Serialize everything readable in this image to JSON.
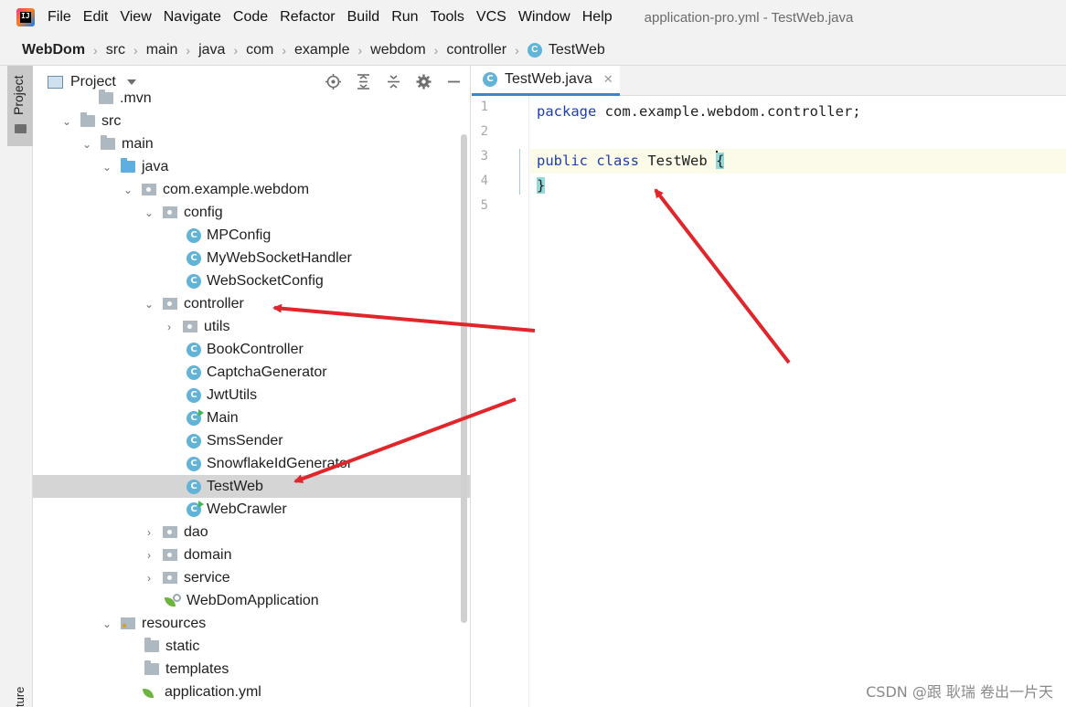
{
  "menubar": {
    "items": [
      "File",
      "Edit",
      "View",
      "Navigate",
      "Code",
      "Refactor",
      "Build",
      "Run",
      "Tools",
      "VCS",
      "Window",
      "Help"
    ],
    "window_title": "application-pro.yml - TestWeb.java"
  },
  "breadcrumb": {
    "items": [
      "WebDom",
      "src",
      "main",
      "java",
      "com",
      "example",
      "webdom",
      "controller",
      "TestWeb"
    ]
  },
  "tool_strip": {
    "project_label": "Project",
    "structure_label": "ture"
  },
  "project_panel": {
    "title": "Project",
    "tree": [
      {
        "label": ".mvn",
        "icon": "folder-icon"
      },
      {
        "label": "src",
        "icon": "folder-icon"
      },
      {
        "label": "main",
        "icon": "folder-icon"
      },
      {
        "label": "java",
        "icon": "source-folder-icon"
      },
      {
        "label": "com.example.webdom",
        "icon": "package-icon"
      },
      {
        "label": "config",
        "icon": "package-icon"
      },
      {
        "label": "MPConfig",
        "icon": "class-icon"
      },
      {
        "label": "MyWebSocketHandler",
        "icon": "class-icon"
      },
      {
        "label": "WebSocketConfig",
        "icon": "class-icon"
      },
      {
        "label": "controller",
        "icon": "package-icon"
      },
      {
        "label": "utils",
        "icon": "package-icon"
      },
      {
        "label": "BookController",
        "icon": "class-icon"
      },
      {
        "label": "CaptchaGenerator",
        "icon": "class-icon"
      },
      {
        "label": "JwtUtils",
        "icon": "class-icon"
      },
      {
        "label": "Main",
        "icon": "runnable-class-icon"
      },
      {
        "label": "SmsSender",
        "icon": "class-icon"
      },
      {
        "label": "SnowflakeIdGenerator",
        "icon": "class-icon"
      },
      {
        "label": "TestWeb",
        "icon": "class-icon"
      },
      {
        "label": "WebCrawler",
        "icon": "runnable-class-icon"
      },
      {
        "label": "dao",
        "icon": "package-icon"
      },
      {
        "label": "domain",
        "icon": "package-icon"
      },
      {
        "label": "service",
        "icon": "package-icon"
      },
      {
        "label": "WebDomApplication",
        "icon": "spring-boot-class-icon"
      },
      {
        "label": "resources",
        "icon": "resources-folder-icon"
      },
      {
        "label": "static",
        "icon": "folder-icon"
      },
      {
        "label": "templates",
        "icon": "folder-icon"
      },
      {
        "label": "application.yml",
        "icon": "spring-config-icon"
      }
    ],
    "selected_item": "TestWeb"
  },
  "editor": {
    "tab_label": "TestWeb.java",
    "line_numbers": [
      "1",
      "2",
      "3",
      "4",
      "5"
    ],
    "code": {
      "l1_kw": "package",
      "l1_rest": " com.example.webdom.controller;",
      "l3_kw1": "public",
      "l3_kw2": "class",
      "l3_name": " TestWeb ",
      "l3_brace": "{",
      "l4_brace": "}"
    },
    "current_line": 3
  },
  "watermark": "CSDN @跟 耿瑞 卷出一片天",
  "colors": {
    "class_icon": "#62b3d8",
    "keyword": "#1e3fa8",
    "selection": "#d5d5d5",
    "annotation_arrow": "#e0262b"
  }
}
